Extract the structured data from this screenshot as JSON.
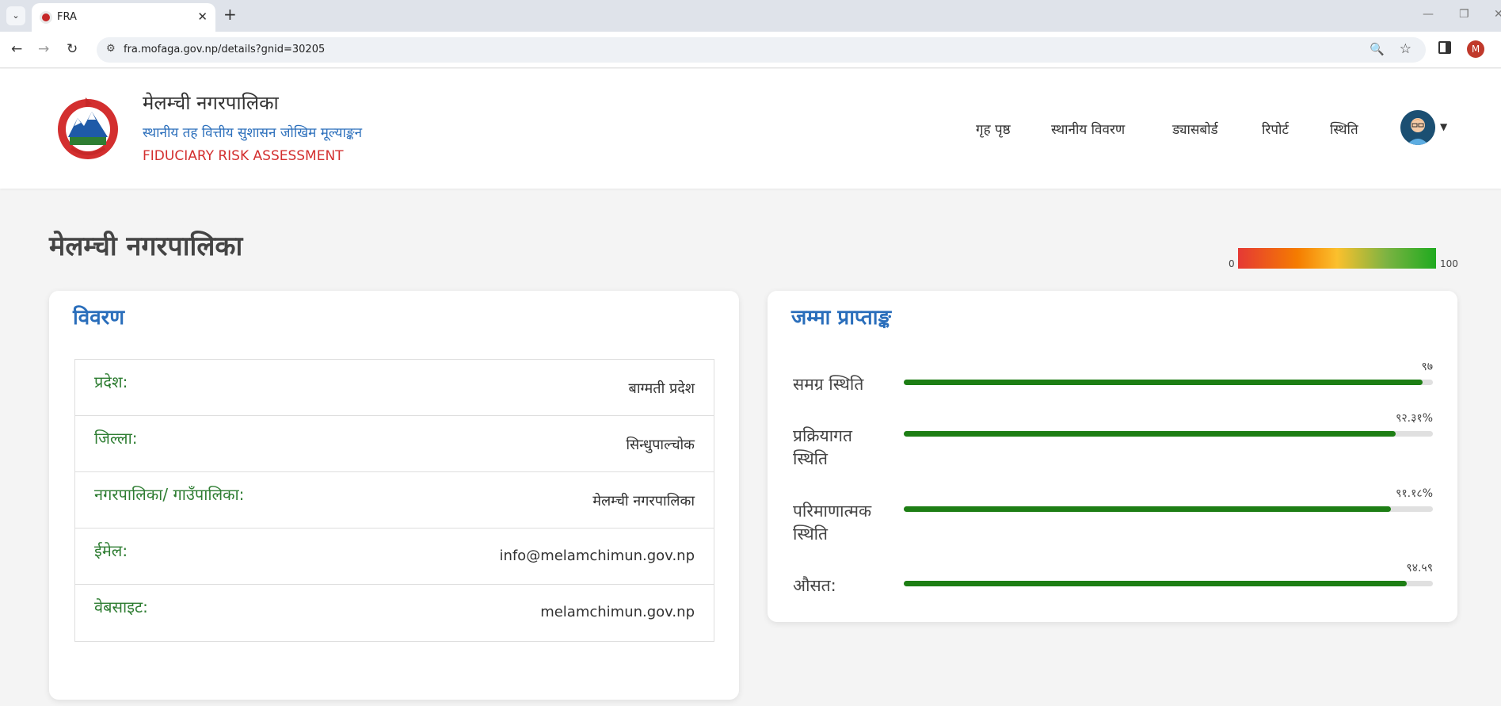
{
  "browser": {
    "tab_title": "FRA",
    "url": "fra.mofaga.gov.np/details?gnid=30205",
    "profile_initial": "M"
  },
  "header": {
    "name": "मेलम्ची नगरपालिका",
    "subtitle": "स्थानीय तह वित्तीय सुशासन जोखिम मूल्याङ्कन",
    "english": "FIDUCIARY RISK ASSESSMENT",
    "nav": [
      "गृह पृष्ठ",
      "स्थानीय विवरण",
      "ड्यासबोर्ड",
      "रिपोर्ट",
      "स्थिति"
    ]
  },
  "page": {
    "title": "मेलम्ची नगरपालिका",
    "scale_min": "0",
    "scale_max": "100"
  },
  "details": {
    "heading": "विवरण",
    "rows": [
      {
        "label": "प्रदेश:",
        "value": "बाग्मती प्रदेश"
      },
      {
        "label": "जिल्ला:",
        "value": "सिन्धुपाल्चोक"
      },
      {
        "label": "नगरपालिका/ गाउँपालिका:",
        "value": "मेलम्ची नगरपालिका"
      },
      {
        "label": "ईमेल:",
        "value": "info@melamchimun.gov.np"
      },
      {
        "label": "वेबसाइट:",
        "value": "melamchimun.gov.np"
      }
    ]
  },
  "scores": {
    "heading": "जम्मा प्राप्ताङ्क",
    "items": [
      {
        "label": "समग्र स्थिति",
        "value_text": "९७",
        "percent": 98
      },
      {
        "label": "प्रक्रियागत स्थिति",
        "value_text": "९२.३१%",
        "percent": 93
      },
      {
        "label": "परिमाणात्मक स्थिति",
        "value_text": "९१.१८%",
        "percent": 92
      },
      {
        "label": "औसत:",
        "value_text": "९४.५९",
        "percent": 95
      }
    ]
  },
  "colors": {
    "nav_accent": "#2a6ebb",
    "brand_red": "#d32f2f",
    "label_green": "#2e7d32",
    "bar_green": "#1d7e14"
  }
}
